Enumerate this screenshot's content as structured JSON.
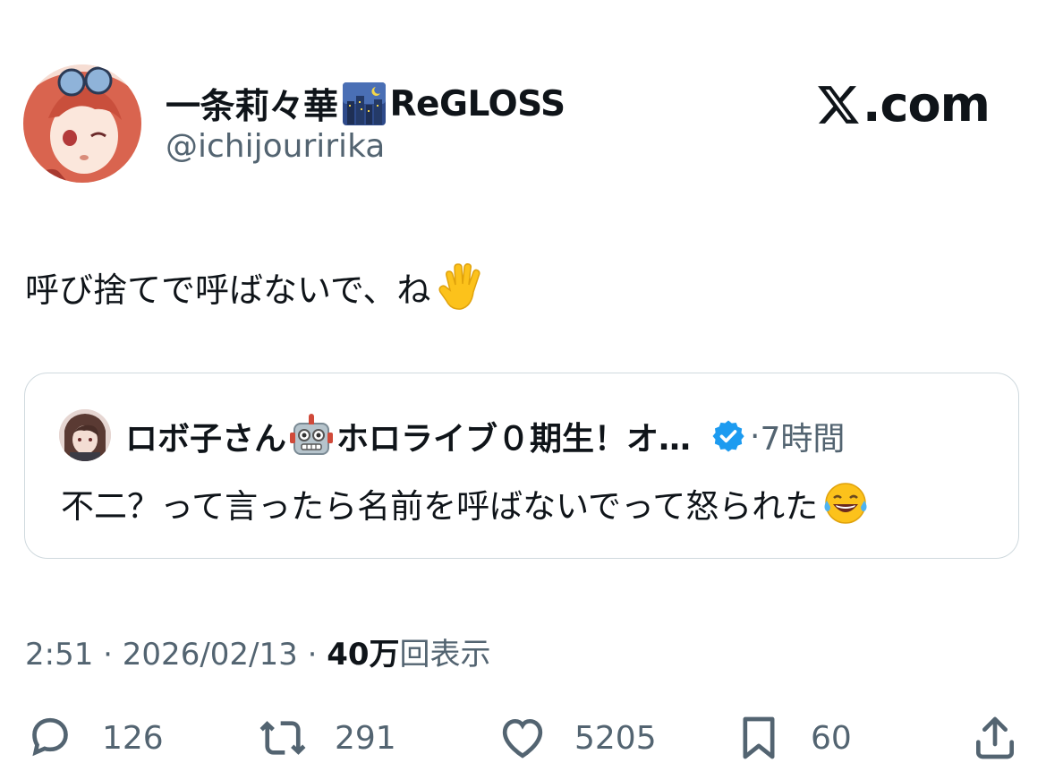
{
  "author": {
    "display_name": "一条莉々華",
    "display_name_suffix": "ReGLOSS",
    "name_emoji": "night-city-emoji",
    "handle": "@ichijouririka",
    "avatar": "anime-girl-avatar"
  },
  "brand": {
    "logo": "x-logo-icon",
    "label": ".com"
  },
  "tweet": {
    "text": "呼び捨てで呼ばないで、ね",
    "emoji": "raised-hand-emoji"
  },
  "quote": {
    "author_name": "ロボ子さん",
    "author_name_suffix": "ホロライブ０期生！オ…",
    "name_emoji": "robot-emoji",
    "verified": "verified-badge-icon",
    "separator": "·",
    "time": "7時間",
    "text": "不二？って言ったら名前を呼ばないでって怒られた",
    "text_emoji": "tears-of-joy-emoji"
  },
  "meta": {
    "time": "2:51",
    "sep1": " · ",
    "date": "2026/02/13",
    "sep2": " · ",
    "views_count": "40万",
    "views_label": "回表示"
  },
  "actions": {
    "replies": {
      "icon": "reply-icon",
      "count": "126"
    },
    "reposts": {
      "icon": "repost-icon",
      "count": "291"
    },
    "likes": {
      "icon": "heart-icon",
      "count": "5205"
    },
    "bookmarks": {
      "icon": "bookmark-icon",
      "count": "60"
    },
    "share": {
      "icon": "share-icon"
    }
  },
  "colors": {
    "text": "#0f1419",
    "muted": "#536471",
    "border": "#cfd9de",
    "verified_blue": "#1d9bf0"
  }
}
